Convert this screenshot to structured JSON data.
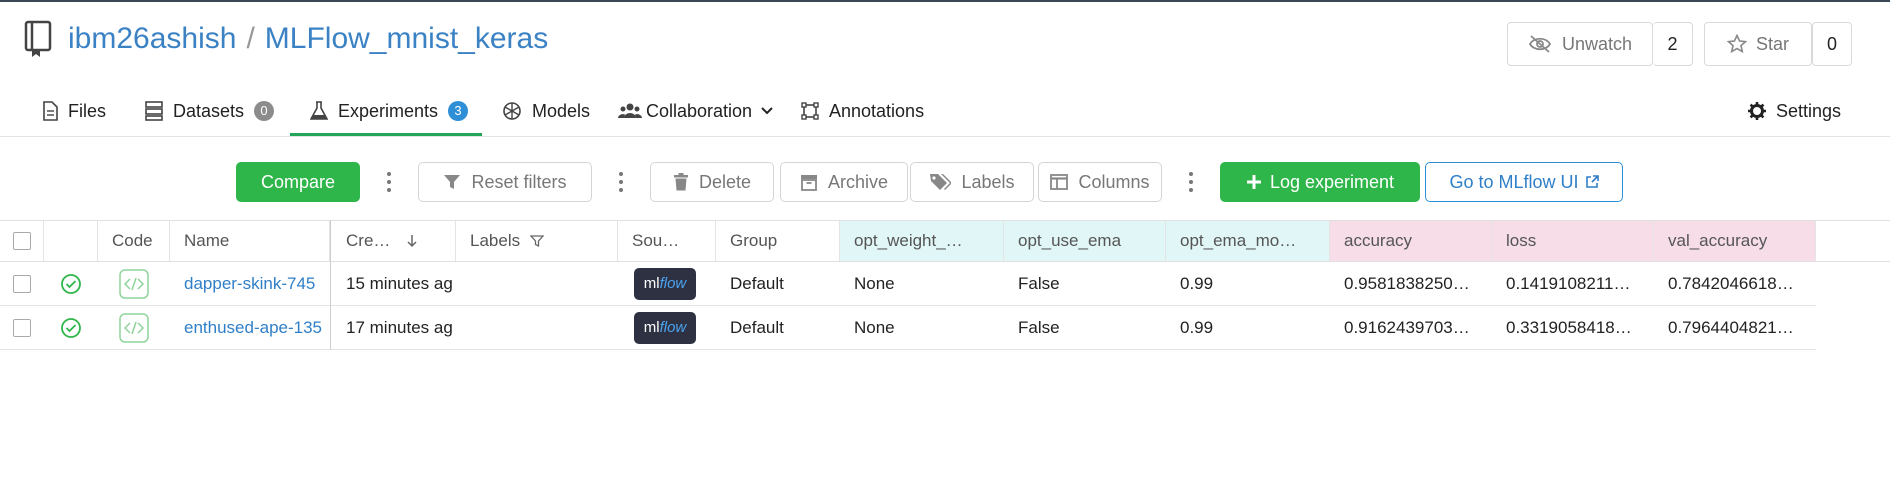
{
  "header": {
    "owner": "ibm26ashish",
    "separator": "/",
    "repo": "MLFlow_mnist_keras",
    "unwatch_label": "Unwatch",
    "watch_count": "2",
    "star_label": "Star",
    "star_count": "0"
  },
  "tabs": {
    "files": "Files",
    "datasets": "Datasets",
    "datasets_count": "0",
    "experiments": "Experiments",
    "experiments_count": "3",
    "models": "Models",
    "collaboration": "Collaboration",
    "annotations": "Annotations",
    "settings": "Settings"
  },
  "toolbar": {
    "compare": "Compare",
    "reset_filters": "Reset filters",
    "delete": "Delete",
    "archive": "Archive",
    "labels": "Labels",
    "columns": "Columns",
    "log_experiment": "Log experiment",
    "go_mlflow": "Go to MLflow UI"
  },
  "table": {
    "headers": {
      "code": "Code",
      "name": "Name",
      "created": "Cre…",
      "labels": "Labels",
      "source": "Sou…",
      "group": "Group",
      "opt_weight": "opt_weight_…",
      "opt_use_ema": "opt_use_ema",
      "opt_ema_mo": "opt_ema_mo…",
      "accuracy": "accuracy",
      "loss": "loss",
      "val_accuracy": "val_accuracy"
    },
    "rows": [
      {
        "name": "dapper-skink-745",
        "created": "15 minutes ag",
        "source_ml": "ml",
        "source_flow": "flow",
        "group": "Default",
        "opt_weight": "None",
        "opt_use_ema": "False",
        "opt_ema_mo": "0.99",
        "accuracy": "0.9581838250…",
        "loss": "0.1419108211…",
        "val_accuracy": "0.7842046618…"
      },
      {
        "name": "enthused-ape-135",
        "created": "17 minutes ag",
        "source_ml": "ml",
        "source_flow": "flow",
        "group": "Default",
        "opt_weight": "None",
        "opt_use_ema": "False",
        "opt_ema_mo": "0.99",
        "accuracy": "0.9162439703…",
        "loss": "0.3319058418…",
        "val_accuracy": "0.7964404821…"
      }
    ]
  },
  "colors": {
    "accent_green": "#2fb64a",
    "link_blue": "#2f7fc8",
    "param_header_bg": "#e1f6f6",
    "metric_header_bg": "#f6dde7"
  }
}
